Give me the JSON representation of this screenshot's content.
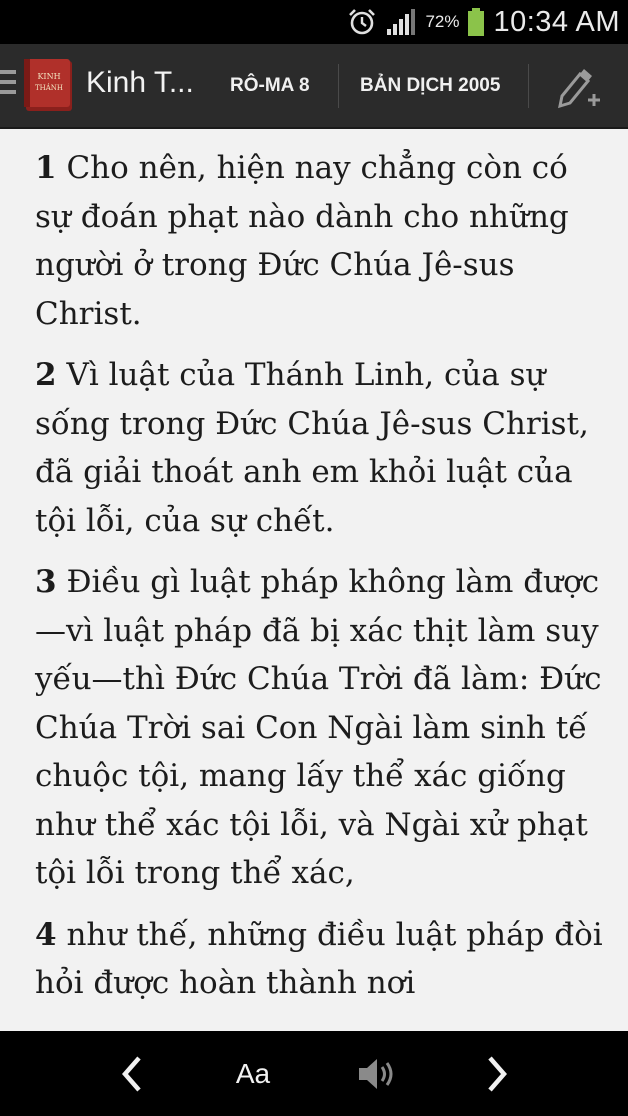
{
  "status_bar": {
    "battery_percent": "72%",
    "time": "10:34 AM",
    "icons": [
      "alarm-icon",
      "signal-icon",
      "battery-icon"
    ]
  },
  "action_bar": {
    "app_title": "Kinh T...",
    "logo_text_line1": "KINH",
    "logo_text_line2": "THÁNH",
    "book_chapter": "RÔ-MA 8",
    "version": "BẢN DỊCH 2005",
    "icons": [
      "menu-icon",
      "edit-add-icon"
    ]
  },
  "verses": [
    {
      "number": "1",
      "text": "Cho nên, hiện nay chẳng còn có sự đoán phạt nào dành cho những người ở trong Đức Chúa Jê-sus Christ."
    },
    {
      "number": "2",
      "text": "Vì luật của Thánh Linh, của sự sống trong Đức Chúa Jê-sus Christ, đã giải thoát anh em khỏi luật của tội lỗi, của sự chết."
    },
    {
      "number": "3",
      "text": "Điều gì luật pháp không làm được—vì luật pháp đã bị xác thịt làm suy yếu—thì Đức Chúa Trời đã làm: Đức Chúa Trời sai Con Ngài làm sinh tế chuộc tội, mang lấy thể xác giống như thể xác tội lỗi, và Ngài xử phạt tội lỗi trong thể xác,"
    },
    {
      "number": "4",
      "text": "như thế, những điều luật pháp đòi hỏi được hoàn thành nơi"
    }
  ],
  "bottom_bar": {
    "font_label": "Aa",
    "icons": [
      "chevron-left-icon",
      "speaker-icon",
      "chevron-right-icon"
    ]
  },
  "colors": {
    "status_bg": "#000000",
    "actionbar_bg": "#2b2b2b",
    "content_bg": "#f2f2f2",
    "battery_green": "#8bc34a",
    "logo_red": "#b0302a"
  }
}
